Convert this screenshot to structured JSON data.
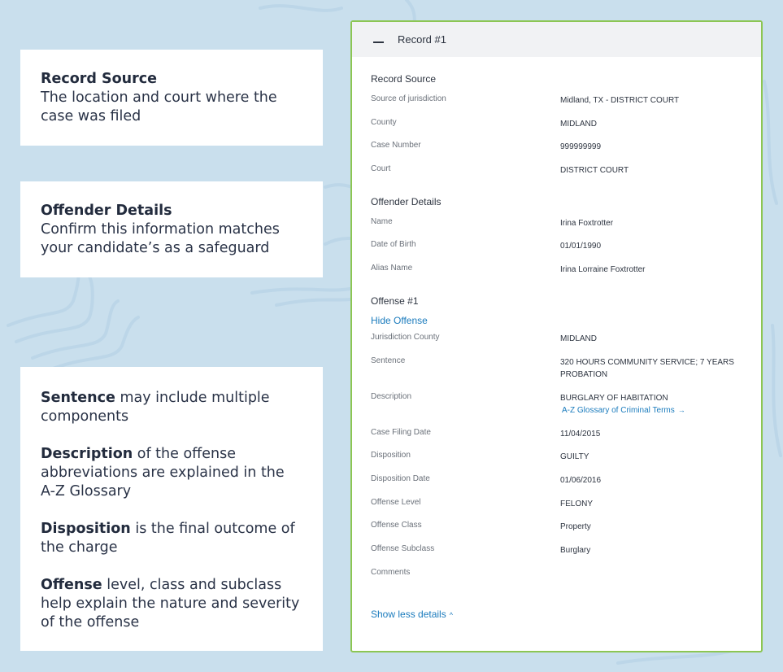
{
  "callouts": [
    {
      "title": "Record Source",
      "text": "The location and court where the case was filed"
    },
    {
      "title": "Offender Details",
      "text": "Confirm this information matches your candidate’s as a safeguard"
    },
    {
      "items": [
        {
          "bold": "Sentence",
          "text": " may include multiple components"
        },
        {
          "bold": "Description",
          "text": " of the offense abbreviations are explained in the A-Z Glossary"
        },
        {
          "bold": "Disposition",
          "text": " is the final outcome of the charge"
        },
        {
          "bold": "Offense",
          "text": " level, class and subclass help explain the nature and severity of the offense"
        }
      ]
    }
  ],
  "record": {
    "title": "Record #1",
    "collapse_icon": "minus-icon",
    "record_source": {
      "title": "Record Source",
      "rows": [
        {
          "label": "Source of jurisdiction",
          "value": "Midland, TX - DISTRICT COURT"
        },
        {
          "label": "County",
          "value": "MIDLAND"
        },
        {
          "label": "Case Number",
          "value": "999999999"
        },
        {
          "label": "Court",
          "value": "DISTRICT COURT"
        }
      ]
    },
    "offender_details": {
      "title": "Offender Details",
      "rows": [
        {
          "label": "Name",
          "value": "Irina Foxtrotter"
        },
        {
          "label": "Date of Birth",
          "value": "01/01/1990"
        },
        {
          "label": "Alias Name",
          "value": "Irina Lorraine Foxtrotter"
        }
      ]
    },
    "offense": {
      "title": "Offense #1",
      "hide_link": "Hide Offense",
      "rows": [
        {
          "label": "Jurisdiction County",
          "value": "MIDLAND"
        },
        {
          "label": "Sentence",
          "value": "320 HOURS COMMUNITY SERVICE; 7 YEARS PROBATION"
        },
        {
          "label": "Description",
          "value": "BURGLARY OF HABITATION",
          "link": "A-Z Glossary of Criminal Terms",
          "link_icon": "→"
        },
        {
          "label": "Case Filing Date",
          "value": "11/04/2015"
        },
        {
          "label": "Disposition",
          "value": "GUILTY"
        },
        {
          "label": "Disposition Date",
          "value": "01/06/2016"
        },
        {
          "label": "Offense Level",
          "value": "FELONY"
        },
        {
          "label": "Offense Class",
          "value": "Property"
        },
        {
          "label": "Offense Subclass",
          "value": "Burglary"
        },
        {
          "label": "Comments",
          "value": ""
        }
      ]
    },
    "show_less": {
      "label": "Show less details",
      "icon": "^"
    }
  },
  "colors": {
    "background": "#c9dfed",
    "card_border": "#8cc653",
    "link": "#1a7bbd",
    "header_bg": "#f1f2f4"
  }
}
